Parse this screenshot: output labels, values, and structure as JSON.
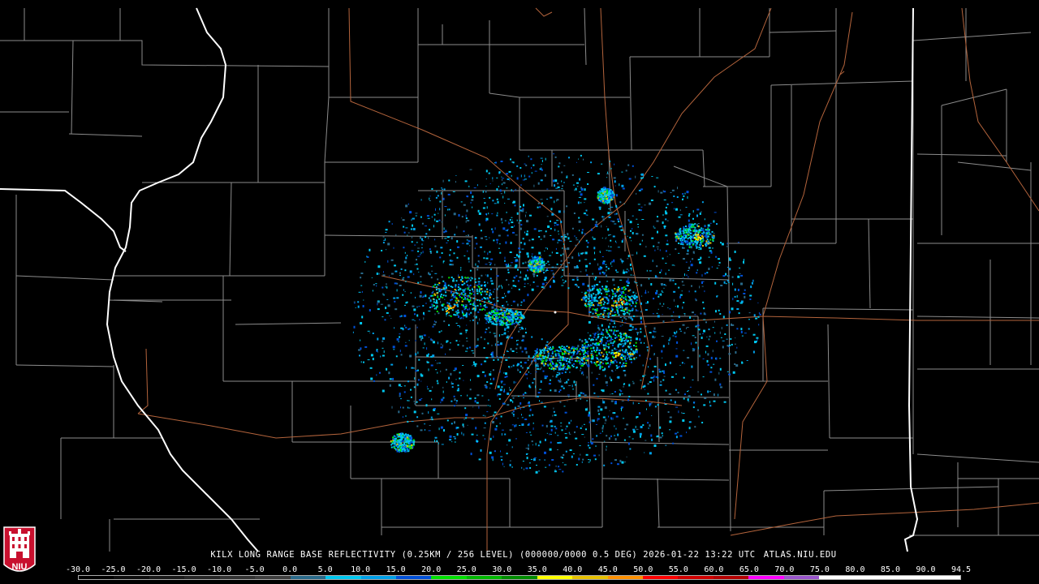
{
  "product": {
    "caption": "KILX LONG RANGE BASE REFLECTIVITY (0.25KM / 256 LEVEL) (000000/0000 0.5 DEG) 2026-01-22 13:22 UTC",
    "site_url": "ATLAS.NIU.EDU"
  },
  "logo": {
    "text": "NIU",
    "color": "#c8102e"
  },
  "colorbar": {
    "labels": [
      "-30.0",
      "-25.0",
      "-20.0",
      "-15.0",
      "-10.0",
      "-5.0",
      "0.0",
      "5.0",
      "10.0",
      "15.0",
      "20.0",
      "25.0",
      "30.0",
      "35.0",
      "40.0",
      "45.0",
      "50.0",
      "55.0",
      "60.0",
      "65.0",
      "70.0",
      "75.0",
      "80.0",
      "85.0",
      "90.0",
      "94.5"
    ],
    "colors": [
      "#000000",
      "#0d0d0d",
      "#1a1a1a",
      "#262626",
      "#333333",
      "#3f3f3f",
      "#2a6a8a",
      "#00c8f0",
      "#00a0e8",
      "#0050d8",
      "#00e000",
      "#00b800",
      "#008c00",
      "#ffff00",
      "#e6c000",
      "#ff9000",
      "#ff0000",
      "#d00000",
      "#b40000",
      "#ff00ff",
      "#9a55cc",
      "#ffffff",
      "#ffffff",
      "#ffffff",
      "#ffffff"
    ]
  },
  "colors": {
    "state_border": "#ffffff",
    "county_border": "#8c8c8c",
    "highway": "#b4643c",
    "background": "#000000"
  }
}
